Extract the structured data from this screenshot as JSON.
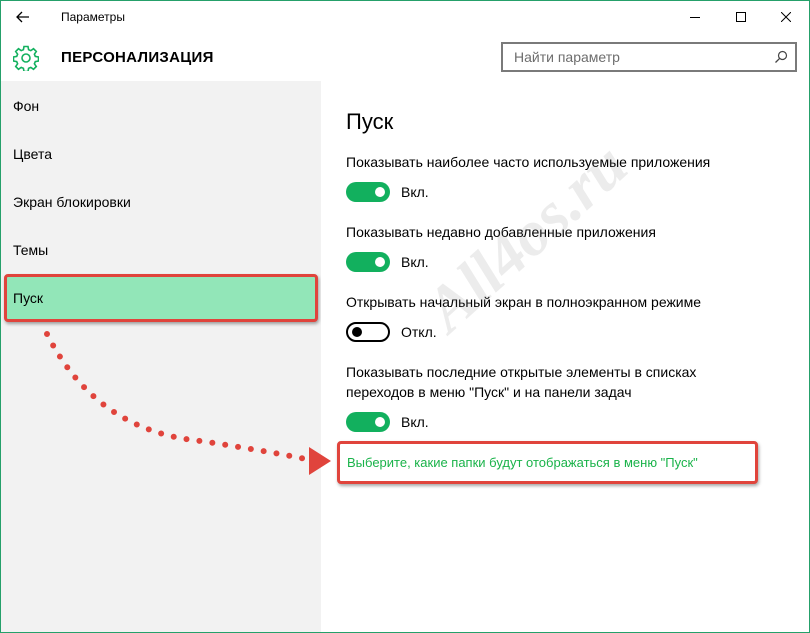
{
  "titlebar": {
    "title": "Параметры",
    "back_icon": "back-arrow-icon",
    "controls": [
      "minimize-icon",
      "maximize-icon",
      "close-icon"
    ]
  },
  "header": {
    "icon": "gear-icon",
    "title": "ПЕРСОНАЛИЗАЦИЯ",
    "search": {
      "placeholder": "Найти параметр",
      "value": "",
      "icon": "search-icon"
    }
  },
  "sidebar": {
    "items": [
      {
        "label": "Фон"
      },
      {
        "label": "Цвета"
      },
      {
        "label": "Экран блокировки"
      },
      {
        "label": "Темы"
      },
      {
        "label": "Пуск",
        "selected": true
      }
    ]
  },
  "main": {
    "title": "Пуск",
    "settings": [
      {
        "label": "Показывать наиболее часто используемые приложения",
        "state": "Вкл.",
        "on": true
      },
      {
        "label": "Показывать недавно добавленные приложения",
        "state": "Вкл.",
        "on": true
      },
      {
        "label": "Открывать начальный экран в полноэкранном режиме",
        "state": "Откл.",
        "on": false
      },
      {
        "label": "Показывать последние открытые элементы в списках переходов в меню \"Пуск\" и на панели задач",
        "state": "Вкл.",
        "on": true
      }
    ],
    "link": "Выберите, какие папки будут отображаться в меню \"Пуск\""
  },
  "watermark": "All4os.ru",
  "colors": {
    "accent": "#12b05e",
    "selection": "#92e6b8",
    "highlight_border": "#e0443c",
    "link": "#1ab34a",
    "sidebar_bg": "#f2f2f2"
  }
}
